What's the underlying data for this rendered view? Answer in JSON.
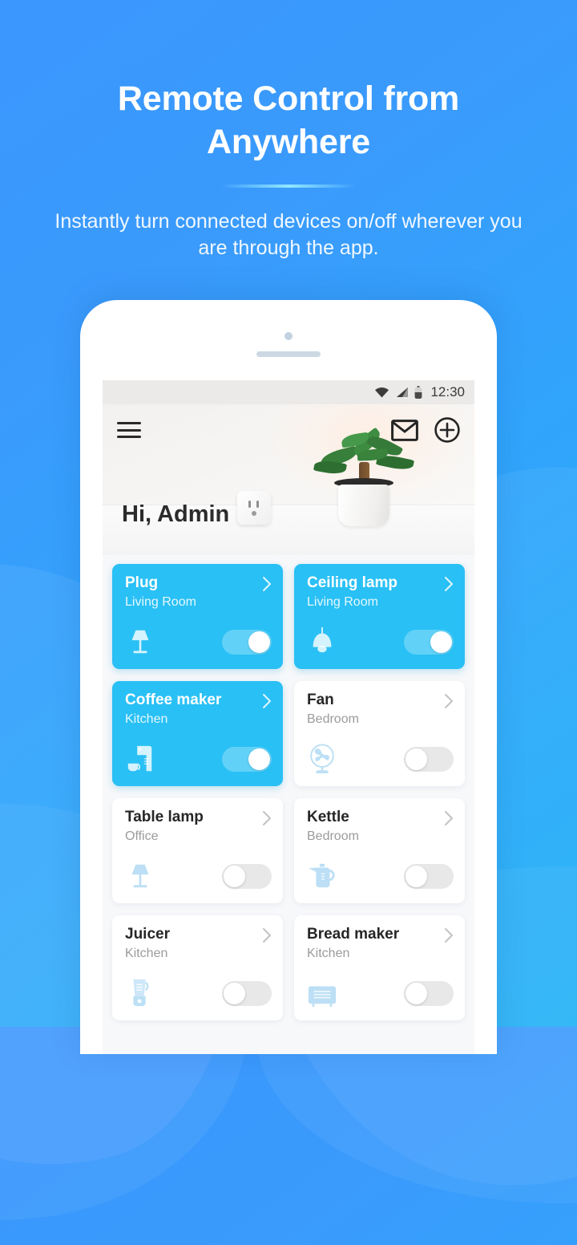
{
  "hero": {
    "title": "Remote Control from Anywhere",
    "subtitle": "Instantly turn connected devices on/off wherever you are through the app.",
    "accent_color": "#8fe6ff"
  },
  "background": {
    "gradient_from": "#3b96fd",
    "gradient_to": "#1eb1f7"
  },
  "phone": {
    "statusbar": {
      "time": "12:30",
      "icons": [
        "wifi-icon",
        "cellular-signal-icon",
        "battery-icon"
      ]
    },
    "appbar": {
      "menu_icon": "hamburger-menu-icon",
      "mail_icon": "mail-envelope-icon",
      "add_icon": "plus-circle-icon"
    },
    "greeting": "Hi, Admin",
    "header_image": "smart-plug-and-plant-photo",
    "accent_color": "#29c0f5",
    "devices": [
      {
        "name": "Plug",
        "room": "Living Room",
        "on": true,
        "icon": "table-lamp-icon"
      },
      {
        "name": "Ceiling lamp",
        "room": "Living Room",
        "on": true,
        "icon": "pendant-lamp-icon"
      },
      {
        "name": "Coffee maker",
        "room": "Kitchen",
        "on": true,
        "icon": "coffee-maker-icon"
      },
      {
        "name": "Fan",
        "room": "Bedroom",
        "on": false,
        "icon": "fan-icon"
      },
      {
        "name": "Table lamp",
        "room": "Office",
        "on": false,
        "icon": "table-lamp-icon"
      },
      {
        "name": "Kettle",
        "room": "Bedroom",
        "on": false,
        "icon": "kettle-icon"
      },
      {
        "name": "Juicer",
        "room": "Kitchen",
        "on": false,
        "icon": "blender-icon"
      },
      {
        "name": "Bread maker",
        "room": "Kitchen",
        "on": false,
        "icon": "toaster-icon"
      }
    ]
  }
}
